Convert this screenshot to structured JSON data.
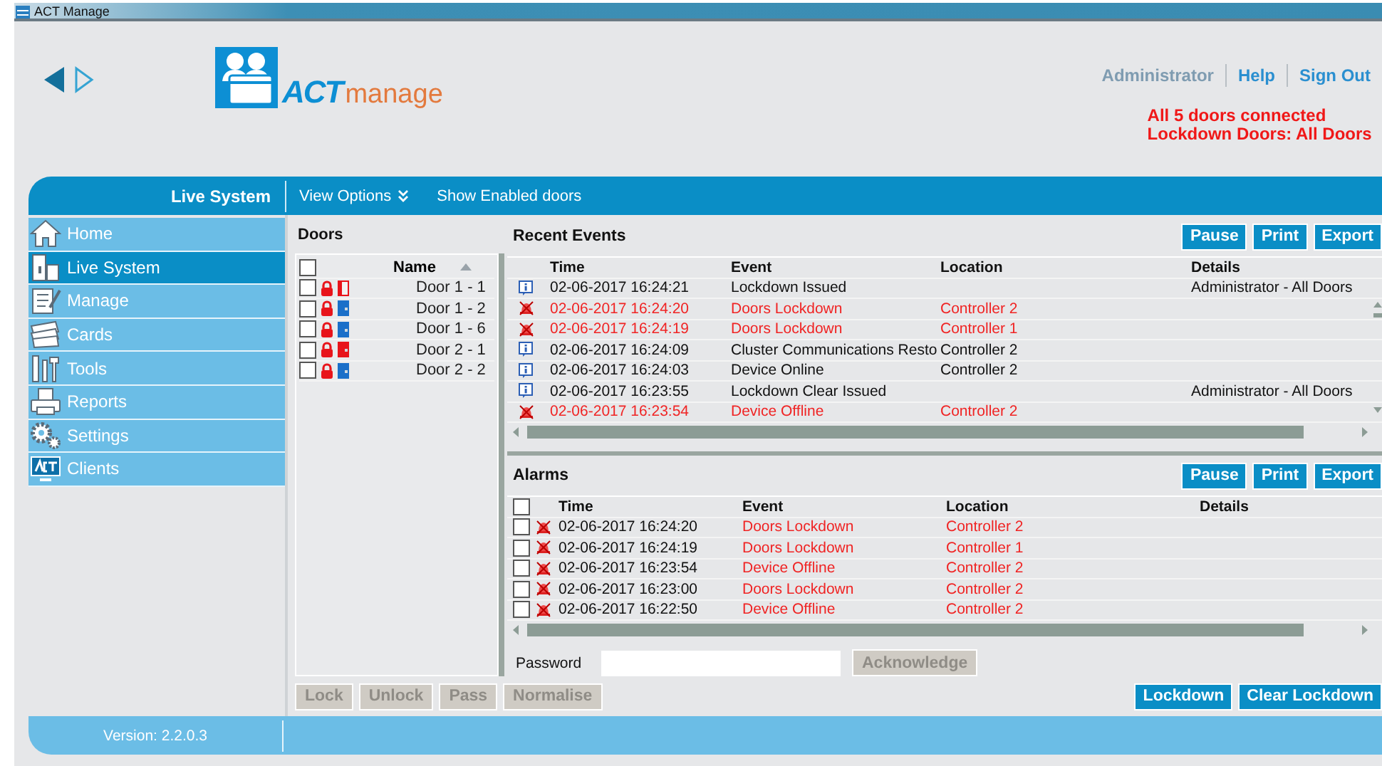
{
  "title_bar": {
    "title": "ACT Manage"
  },
  "logo": {
    "brand": "ACT",
    "product": "manage"
  },
  "user_links": [
    {
      "label": "Administrator",
      "kind": "user"
    },
    {
      "label": "Help",
      "kind": "link"
    },
    {
      "label": "Sign Out",
      "kind": "link"
    }
  ],
  "status_messages": [
    "All 5 doors connected",
    "Lockdown Doors: All Doors"
  ],
  "toolbar": {
    "section": "Live System",
    "items": [
      {
        "label": "View Options",
        "kind": "menu"
      },
      {
        "label": "Show Enabled doors",
        "kind": "plain"
      }
    ]
  },
  "sidebar": {
    "items": [
      {
        "label": "Home",
        "selected": false
      },
      {
        "label": "Live System",
        "selected": true
      },
      {
        "label": "Manage",
        "selected": false
      },
      {
        "label": "Cards",
        "selected": false
      },
      {
        "label": "Tools",
        "selected": false
      },
      {
        "label": "Reports",
        "selected": false
      },
      {
        "label": "Settings",
        "selected": false
      },
      {
        "label": "Clients",
        "selected": false
      }
    ]
  },
  "doors": {
    "title": "Doors",
    "column": "Name",
    "select_all": false,
    "rows": [
      {
        "name": "Door 1 - 1",
        "checked": false,
        "kind": "open",
        "color": "#e8141b"
      },
      {
        "name": "Door 1 - 2",
        "checked": false,
        "kind": "closed",
        "color": "#1a6fc9"
      },
      {
        "name": "Door 1 - 6",
        "checked": false,
        "kind": "closed",
        "color": "#1a6fc9"
      },
      {
        "name": "Door 2 - 1",
        "checked": false,
        "kind": "closed",
        "color": "#e8141b"
      },
      {
        "name": "Door 2 - 2",
        "checked": false,
        "kind": "closed",
        "color": "#1a6fc9"
      }
    ],
    "buttons": [
      {
        "label": "Lock",
        "disabled": true
      },
      {
        "label": "Unlock",
        "disabled": true
      },
      {
        "label": "Pass",
        "disabled": true
      },
      {
        "label": "Normalise",
        "disabled": true
      }
    ]
  },
  "recent_events": {
    "title": "Recent Events",
    "buttons": [
      "Pause",
      "Print",
      "Export"
    ],
    "columns": [
      "Time",
      "Event",
      "Location",
      "Details"
    ],
    "rows": [
      {
        "kind": "info",
        "time": "02-06-2017 16:24:21",
        "event": "Lockdown Issued",
        "location": "",
        "details": "Administrator - All Doors"
      },
      {
        "kind": "alarm",
        "time": "02-06-2017 16:24:20",
        "event": "Doors Lockdown",
        "location": "Controller 2",
        "details": ""
      },
      {
        "kind": "alarm",
        "time": "02-06-2017 16:24:19",
        "event": "Doors Lockdown",
        "location": "Controller 1",
        "details": ""
      },
      {
        "kind": "info",
        "time": "02-06-2017 16:24:09",
        "event": "Cluster Communications Resto",
        "location": "Controller 2",
        "details": ""
      },
      {
        "kind": "info",
        "time": "02-06-2017 16:24:03",
        "event": "Device Online",
        "location": "Controller 2",
        "details": ""
      },
      {
        "kind": "info",
        "time": "02-06-2017 16:23:55",
        "event": "Lockdown Clear Issued",
        "location": "",
        "details": "Administrator - All Doors"
      },
      {
        "kind": "alarm",
        "time": "02-06-2017 16:23:54",
        "event": "Device Offline",
        "location": "Controller 2",
        "details": ""
      }
    ]
  },
  "alarms": {
    "title": "Alarms",
    "buttons": [
      "Pause",
      "Print",
      "Export"
    ],
    "select_all": false,
    "columns": [
      "Time",
      "Event",
      "Location",
      "Details"
    ],
    "rows": [
      {
        "checked": false,
        "time": "02-06-2017 16:24:20",
        "event": "Doors Lockdown",
        "location": "Controller 2"
      },
      {
        "checked": false,
        "time": "02-06-2017 16:24:19",
        "event": "Doors Lockdown",
        "location": "Controller 1"
      },
      {
        "checked": false,
        "time": "02-06-2017 16:23:54",
        "event": "Device Offline",
        "location": "Controller 2"
      },
      {
        "checked": false,
        "time": "02-06-2017 16:23:00",
        "event": "Doors Lockdown",
        "location": "Controller 2"
      },
      {
        "checked": false,
        "time": "02-06-2017 16:22:50",
        "event": "Device Offline",
        "location": "Controller 2"
      }
    ],
    "password": {
      "label": "Password"
    },
    "acknowledge": {
      "label": "Acknowledge",
      "disabled": true
    }
  },
  "lockdown_buttons": [
    "Lockdown",
    "Clear Lockdown"
  ],
  "footer": {
    "version": "Version: 2.2.0.3"
  }
}
